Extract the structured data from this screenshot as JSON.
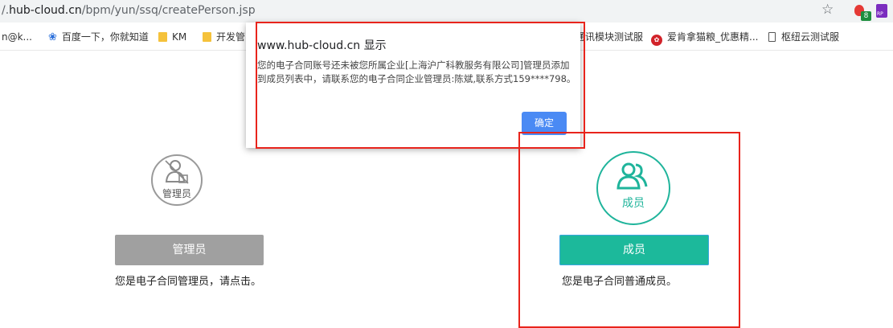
{
  "browser": {
    "url_prefix": "/.",
    "url_host": "hub-cloud.cn",
    "url_path": "/bpm/yun/ssq/createPerson.jsp",
    "star_icon": "star-icon",
    "extension_badge": "8",
    "extension_label": "RP"
  },
  "bookmarks": [
    {
      "label": "n@k...",
      "icon": ""
    },
    {
      "label": "百度一下，你就知道",
      "icon": "paw-icon"
    },
    {
      "label": "KM",
      "icon": "folder-icon"
    },
    {
      "label": "开发管",
      "icon": "folder-icon"
    },
    {
      "label": "通讯模块测试服",
      "icon": ""
    },
    {
      "label": "爱肯拿猫粮_优惠精...",
      "icon": "brand-icon"
    },
    {
      "label": "枢纽云测试服",
      "icon": "page-icon"
    }
  ],
  "dialog": {
    "title": "www.hub-cloud.cn 显示",
    "message": "您的电子合同账号还未被您所属企业[上海沪广科教服务有限公司]管理员添加到成员列表中，请联系您的电子合同企业管理员:陈斌,联系方式159****798。",
    "ok_label": "确定",
    "ok_color": "#4a8af4"
  },
  "roles": {
    "admin": {
      "icon_label": "管理员",
      "button_label": "管理员",
      "description": "您是电子合同管理员，请点击。",
      "color": "#a0a0a0"
    },
    "member": {
      "icon_label": "成员",
      "button_label": "成员",
      "description": "您是电子合同普通成员。",
      "color": "#1cb99b"
    }
  },
  "highlight_color": "#e8241c"
}
